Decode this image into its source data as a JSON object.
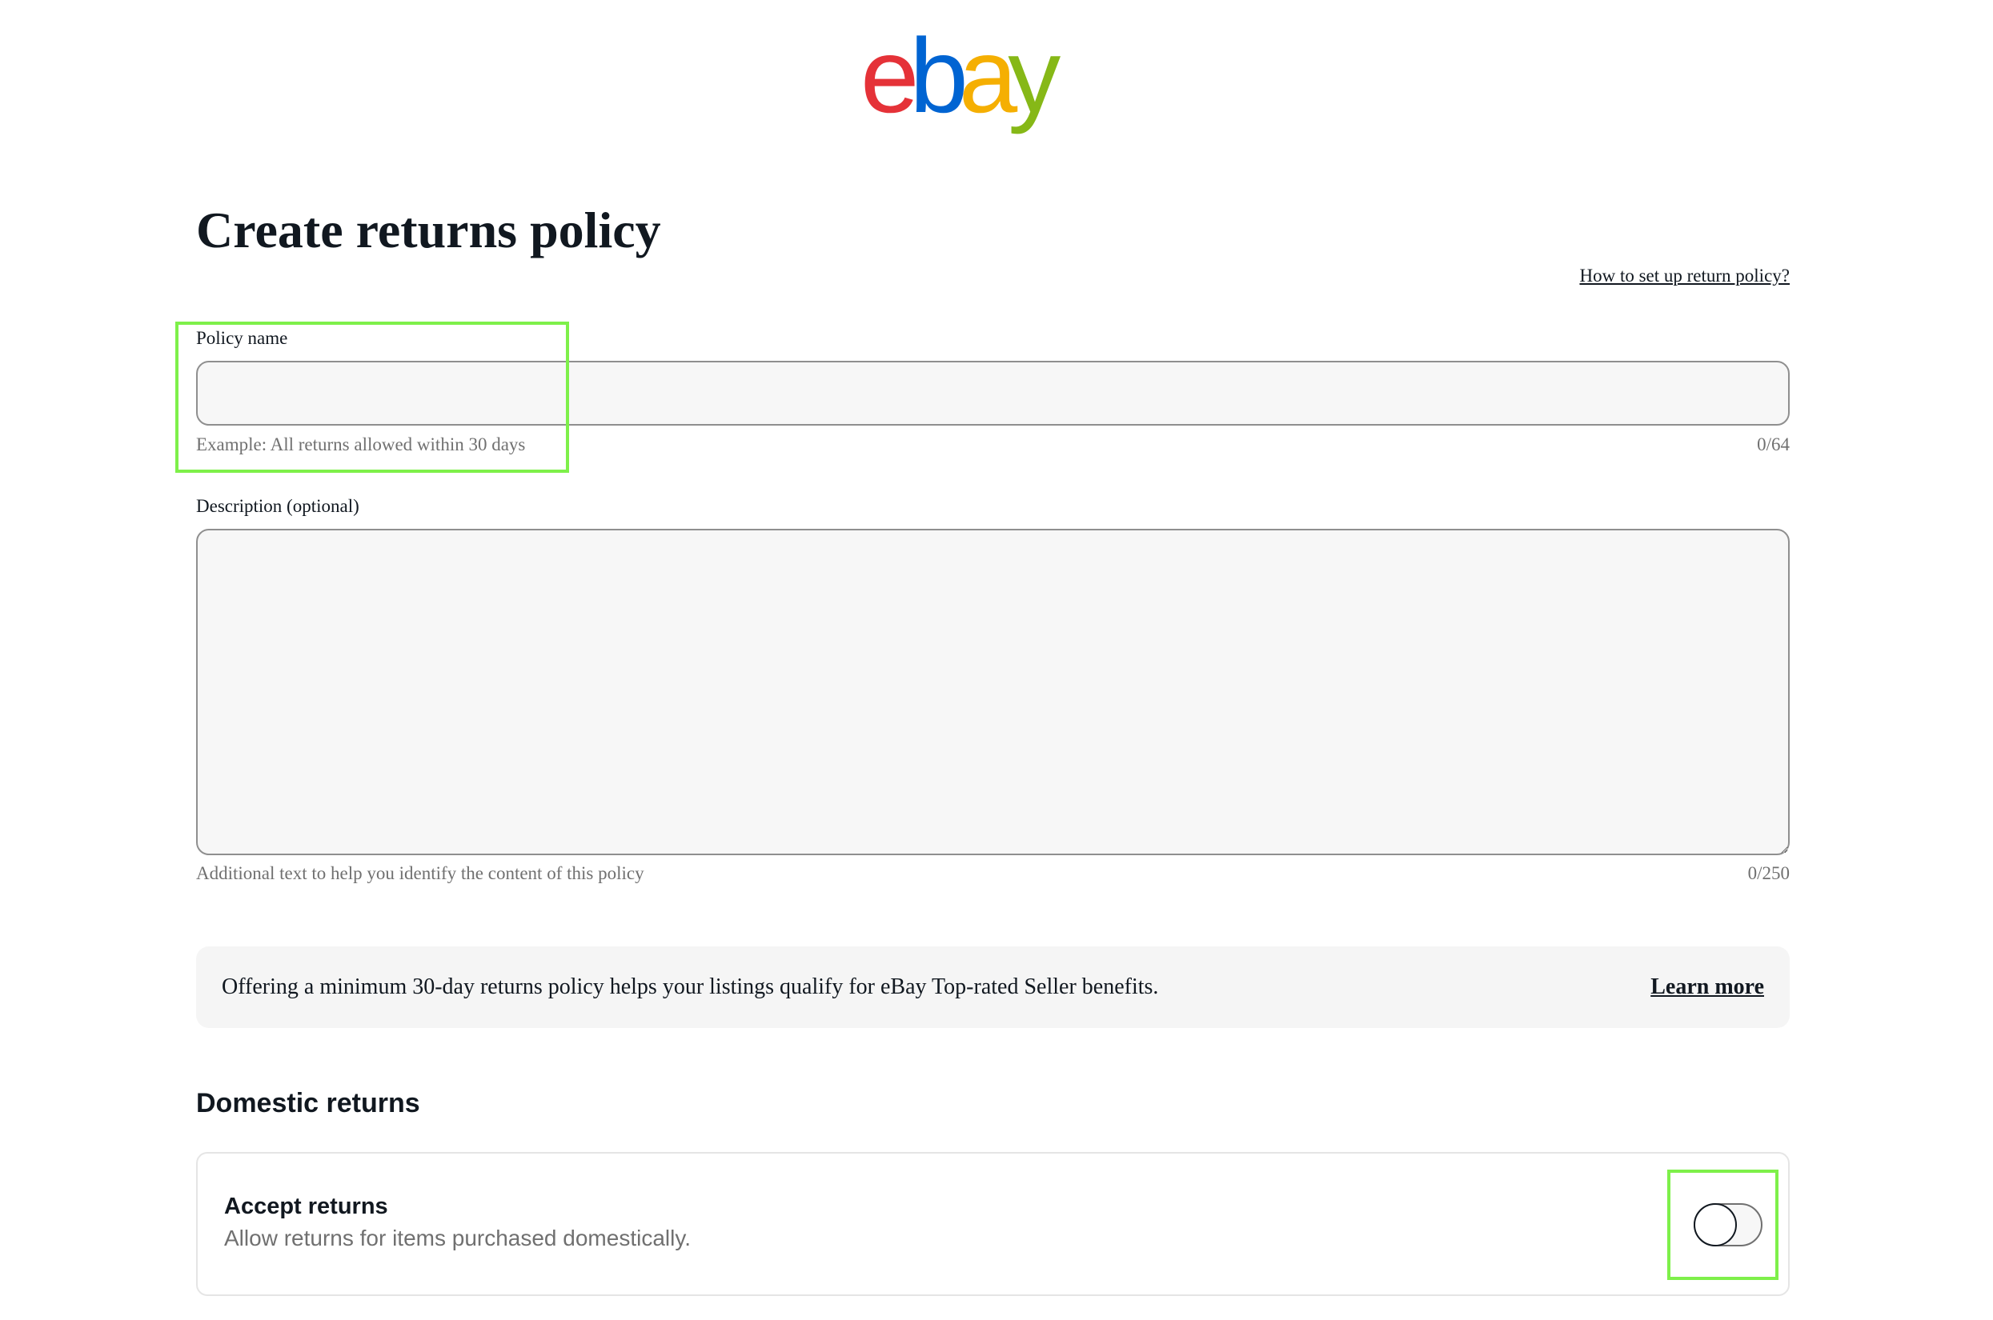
{
  "brand": {
    "logo_letters": [
      "e",
      "b",
      "a",
      "y"
    ],
    "colors": {
      "e": "#e53238",
      "b": "#0064d2",
      "a": "#f5af02",
      "y": "#86b817"
    }
  },
  "header": {
    "title": "Create returns policy",
    "help_link": "How to set up return policy?"
  },
  "policy_name": {
    "label": "Policy name",
    "value": "",
    "helper": "Example: All returns allowed within 30 days",
    "counter": "0/64"
  },
  "description": {
    "label": "Description (optional)",
    "value": "",
    "helper": "Additional text to help you identify the content of this policy",
    "counter": "0/250"
  },
  "info_banner": {
    "text": "Offering a minimum 30-day returns policy helps your listings qualify for eBay Top-rated Seller benefits.",
    "link": "Learn more"
  },
  "domestic_returns": {
    "heading": "Domestic returns",
    "accept_title": "Accept returns",
    "accept_subtitle": "Allow returns for items purchased domestically.",
    "toggle_on": false
  },
  "accent_colors": {
    "text": "#111820",
    "muted": "#707070",
    "highlight": "#7ef04a"
  }
}
